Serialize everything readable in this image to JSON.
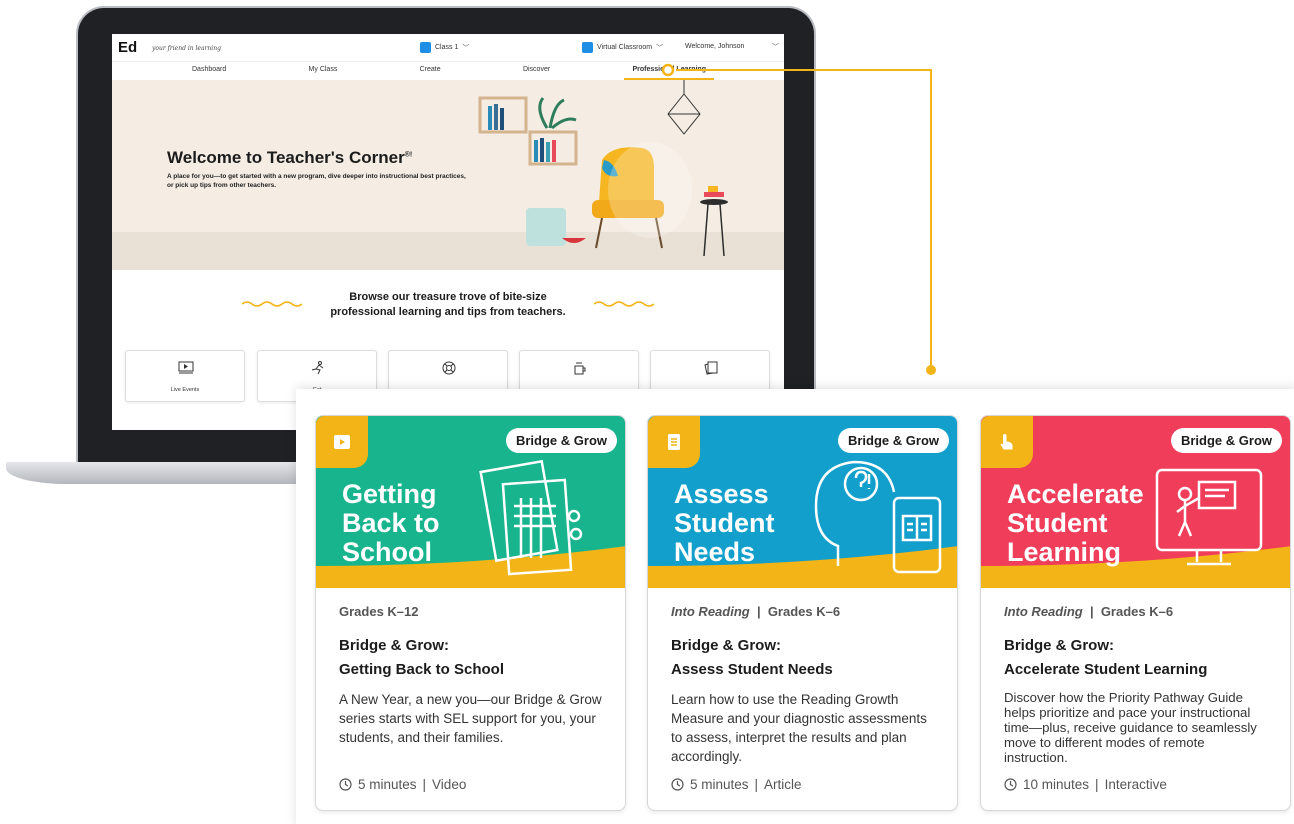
{
  "app": {
    "logo": "Ed",
    "tagline": "your friend in learning",
    "class_selector": "Class 1",
    "virtual_classroom": "Virtual Classroom",
    "welcome": "Welcome, Johnson",
    "nav": [
      "Dashboard",
      "My Class",
      "Create",
      "Discover",
      "Professional Learning"
    ],
    "active_nav": "Professional Learning"
  },
  "hero": {
    "title": "Welcome to Teacher's Corner",
    "title_mark": "®!",
    "subtitle": "A place for you—to get started with a new program, dive deeper into instructional best practices, or pick up tips from other teachers."
  },
  "browse": {
    "line1": "Browse our treasure trove of bite-size",
    "line2": "professional learning and tips from teachers."
  },
  "tiles": [
    {
      "label": "Live Events",
      "icon": "video-screen-icon"
    },
    {
      "label": "Get",
      "icon": "runner-icon"
    },
    {
      "label": "",
      "icon": "lifebuoy-icon"
    },
    {
      "label": "",
      "icon": "coffee-cup-icon"
    },
    {
      "label": "",
      "icon": "cards-icon"
    }
  ],
  "colors": {
    "accent": "#f2b416",
    "card1": "#17b48e",
    "card2": "#129fcc",
    "card3": "#ef3d5a"
  },
  "cards": [
    {
      "type_icon": "play-icon",
      "series": "Bridge & Grow",
      "hero_title": "Getting\nBack to\nSchool",
      "program": "",
      "grades": "Grades K–12",
      "title_line1": "Bridge & Grow:",
      "title_line2": "Getting Back to School",
      "description": "A New Year, a new you—our Bridge & Grow series starts with SEL support for you, your students, and their families.",
      "duration": "5 minutes",
      "format": "Video"
    },
    {
      "type_icon": "document-icon",
      "series": "Bridge & Grow",
      "hero_title": "Assess\nStudent\nNeeds",
      "program": "Into Reading",
      "grades": "Grades K–6",
      "title_line1": "Bridge & Grow:",
      "title_line2": "Assess Student Needs",
      "description": "Learn how to use the Reading Growth Measure and your diagnostic assessments to assess, interpret the results and plan accordingly.",
      "duration": "5 minutes",
      "format": "Article"
    },
    {
      "type_icon": "pointer-hand-icon",
      "series": "Bridge & Grow",
      "hero_title": "Accelerate\nStudent\nLearning",
      "program": "Into Reading",
      "grades": "Grades K–6",
      "title_line1": "Bridge & Grow:",
      "title_line2": "Accelerate Student Learning",
      "description": "Discover how the Priority Pathway Guide helps prioritize and pace your instructional time—plus, receive guidance to seamlessly move to different modes of remote instruction.",
      "duration": "10 minutes",
      "format": "Interactive"
    }
  ]
}
